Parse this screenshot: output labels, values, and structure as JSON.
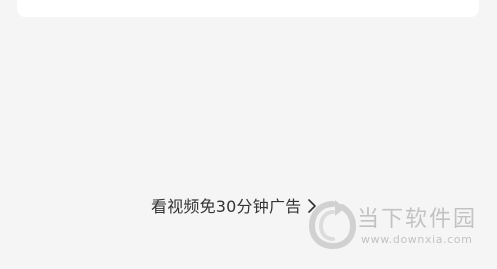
{
  "ad_free_link": {
    "label": "看视频免30分钟广告",
    "icon": "chevron-right-icon"
  },
  "watermark": {
    "name": "当下软件园",
    "url": "www.downxia.com",
    "logo_icon": "downxia-logo-icon"
  },
  "colors": {
    "background": "#f5f5f5",
    "card": "#ffffff",
    "text": "#333333",
    "watermark": "#9a9a9a"
  }
}
